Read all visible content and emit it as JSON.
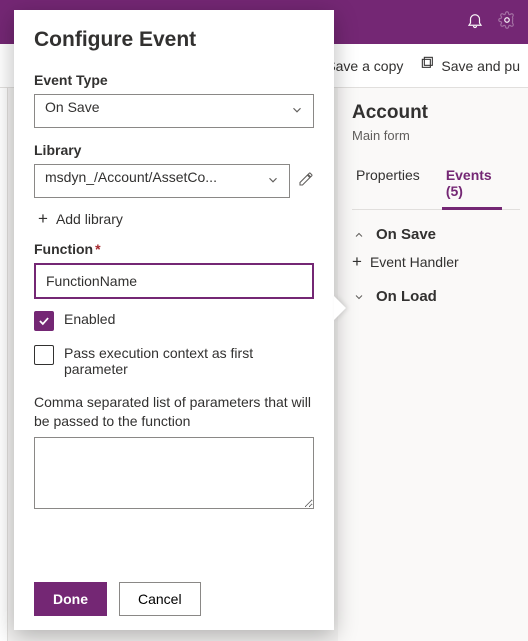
{
  "topbar": {
    "bell_icon": "bell-icon",
    "gear_icon": "gear-icon"
  },
  "cmdbar": {
    "save_copy": "Save a copy",
    "save_publish": "Save and pu"
  },
  "rightpane": {
    "title": "Account",
    "subtitle": "Main form",
    "tabs": {
      "properties": "Properties",
      "events": "Events (5)"
    },
    "sections": {
      "on_save": "On Save",
      "event_handler": "Event Handler",
      "on_load": "On Load"
    }
  },
  "popover": {
    "title": "Configure Event",
    "event_type_label": "Event Type",
    "event_type_value": "On Save",
    "library_label": "Library",
    "library_value": "msdyn_/Account/AssetCo...",
    "add_library": "Add library",
    "function_label": "Function",
    "function_value": "FunctionName",
    "enabled_label": "Enabled",
    "pass_exec_label": "Pass execution context as first parameter",
    "params_desc": "Comma separated list of parameters that will be passed to the function",
    "params_value": "",
    "done": "Done",
    "cancel": "Cancel"
  }
}
